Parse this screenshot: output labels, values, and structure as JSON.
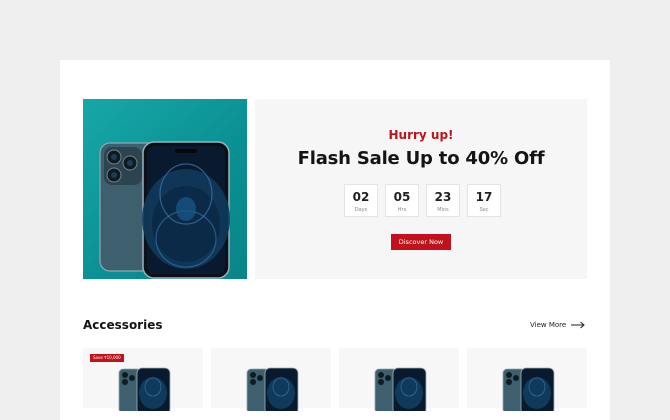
{
  "promo": {
    "eyebrow": "Hurry up!",
    "headline": "Flash Sale Up to 40% Off",
    "countdown": [
      {
        "value": "02",
        "unit": "Days"
      },
      {
        "value": "05",
        "unit": "Hrs"
      },
      {
        "value": "23",
        "unit": "Mins"
      },
      {
        "value": "17",
        "unit": "Sec"
      }
    ],
    "cta_label": "Discover Now",
    "accent_color": "#c1121c",
    "image_bg_color": "#0f9a9c"
  },
  "accessories": {
    "title": "Accessories",
    "view_more_label": "View More",
    "products": [
      {
        "badge": "Save ₹10,000"
      },
      {
        "badge": ""
      },
      {
        "badge": ""
      },
      {
        "badge": ""
      }
    ]
  }
}
